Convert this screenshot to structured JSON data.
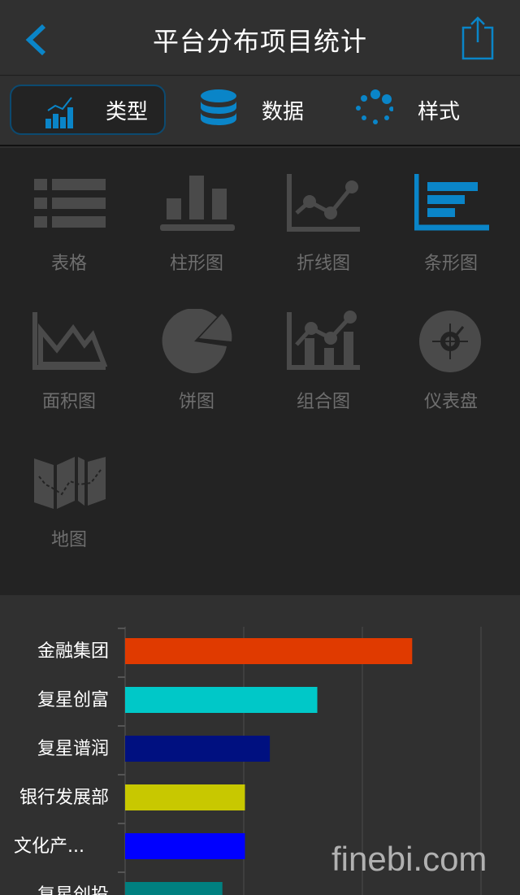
{
  "header": {
    "title": "平台分布项目统计",
    "back_icon": "chevron-left-icon",
    "share_icon": "share-icon",
    "accent": "#0a85c8"
  },
  "tabs": [
    {
      "label": "类型",
      "icon": "bar-line-chart-icon",
      "active": true
    },
    {
      "label": "数据",
      "icon": "database-icon",
      "active": false
    },
    {
      "label": "样式",
      "icon": "dots-circle-icon",
      "active": false
    }
  ],
  "chart_types": [
    {
      "label": "表格",
      "icon": "table-icon",
      "selected": false
    },
    {
      "label": "柱形图",
      "icon": "column-chart-icon",
      "selected": false
    },
    {
      "label": "折线图",
      "icon": "line-chart-icon",
      "selected": false
    },
    {
      "label": "条形图",
      "icon": "bar-chart-icon",
      "selected": true
    },
    {
      "label": "面积图",
      "icon": "area-chart-icon",
      "selected": false
    },
    {
      "label": "饼图",
      "icon": "pie-chart-icon",
      "selected": false
    },
    {
      "label": "组合图",
      "icon": "combo-chart-icon",
      "selected": false
    },
    {
      "label": "仪表盘",
      "icon": "gauge-icon",
      "selected": false
    },
    {
      "label": "地图",
      "icon": "map-icon",
      "selected": false
    }
  ],
  "chart_data": {
    "type": "bar",
    "orientation": "horizontal",
    "categories": [
      "金融集团",
      "复星创富",
      "复星谱润",
      "银行发展部",
      "文化产...",
      "复星创投"
    ],
    "values": [
      2.42,
      1.62,
      1.22,
      1.01,
      1.01,
      0.82
    ],
    "colors": [
      "#e03a00",
      "#00c8c8",
      "#001080",
      "#c8c800",
      "#0000ff",
      "#008080"
    ],
    "xlim": [
      0,
      3
    ],
    "grid": true
  },
  "watermark": "finebi.com"
}
